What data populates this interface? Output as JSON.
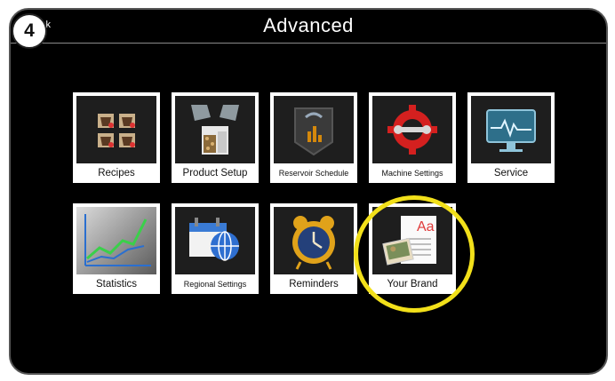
{
  "step_badge": "4",
  "header": {
    "back_label": "ck",
    "title": "Advanced"
  },
  "tiles": [
    {
      "label": "Recipes",
      "icon": "recipes-icon"
    },
    {
      "label": "Product Setup",
      "icon": "product-setup-icon"
    },
    {
      "label": "Reservoir Schedule",
      "icon": "reservoir-schedule-icon"
    },
    {
      "label": "Machine Settings",
      "icon": "machine-settings-icon"
    },
    {
      "label": "Service",
      "icon": "service-icon"
    },
    {
      "label": "Statistics",
      "icon": "statistics-icon"
    },
    {
      "label": "Regional Settings",
      "icon": "regional-settings-icon"
    },
    {
      "label": "Reminders",
      "icon": "reminders-icon"
    },
    {
      "label": "Your Brand",
      "icon": "your-brand-icon"
    }
  ],
  "colors": {
    "highlight": "#f2e01a",
    "background": "#000000",
    "tile": "#ffffff"
  }
}
